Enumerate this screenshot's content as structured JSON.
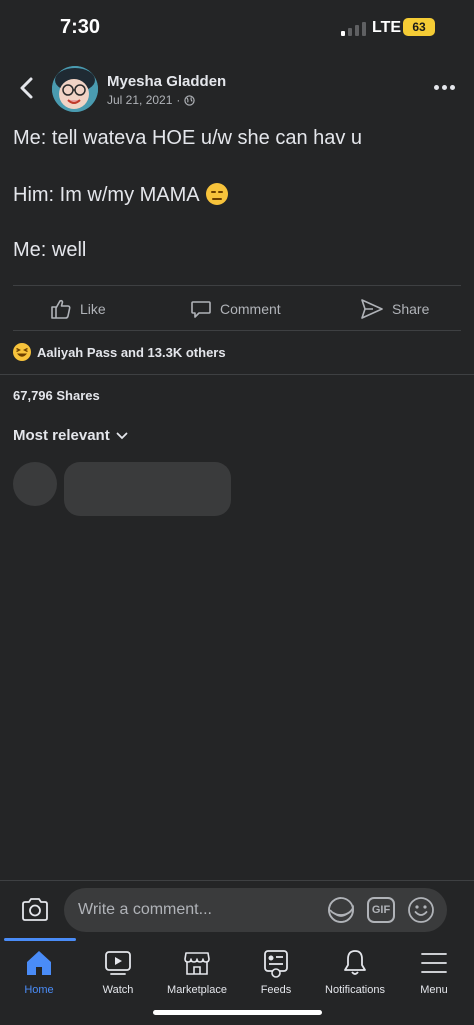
{
  "status_bar": {
    "time": "7:30",
    "network": "LTE",
    "battery": "63"
  },
  "post": {
    "author": "Myesha Gladden",
    "date": "Jul 21, 2021",
    "privacy_icon": "globe-icon",
    "lines": [
      "Me: tell wateva HOE u/w she can hav u",
      "Him: Im w/my MAMA",
      "Me: well"
    ],
    "line2_emoji": "expressionless-face-emoji"
  },
  "actions": {
    "like_label": "Like",
    "comment_label": "Comment",
    "share_label": "Share"
  },
  "reactions": {
    "emoji": "laughing-face-emoji",
    "summary": "Aaliyah Pass and 13.3K others"
  },
  "shares": "67,796 Shares",
  "comments": {
    "sort_label": "Most relevant"
  },
  "composer": {
    "placeholder": "Write a comment...",
    "gif_label": "GIF"
  },
  "nav": {
    "items": [
      {
        "label": "Home",
        "icon": "home-icon",
        "active": true
      },
      {
        "label": "Watch",
        "icon": "video-icon",
        "active": false
      },
      {
        "label": "Marketplace",
        "icon": "shop-icon",
        "active": false
      },
      {
        "label": "Feeds",
        "icon": "feeds-icon",
        "active": false
      },
      {
        "label": "Notifications",
        "icon": "bell-icon",
        "active": false
      },
      {
        "label": "Menu",
        "icon": "hamburger-icon",
        "active": false
      }
    ]
  },
  "colors": {
    "background": "#242526",
    "accent": "#4a8cf7",
    "text_primary": "#e4e6eb",
    "text_secondary": "#b0b3b8",
    "battery": "#f5cc35"
  }
}
